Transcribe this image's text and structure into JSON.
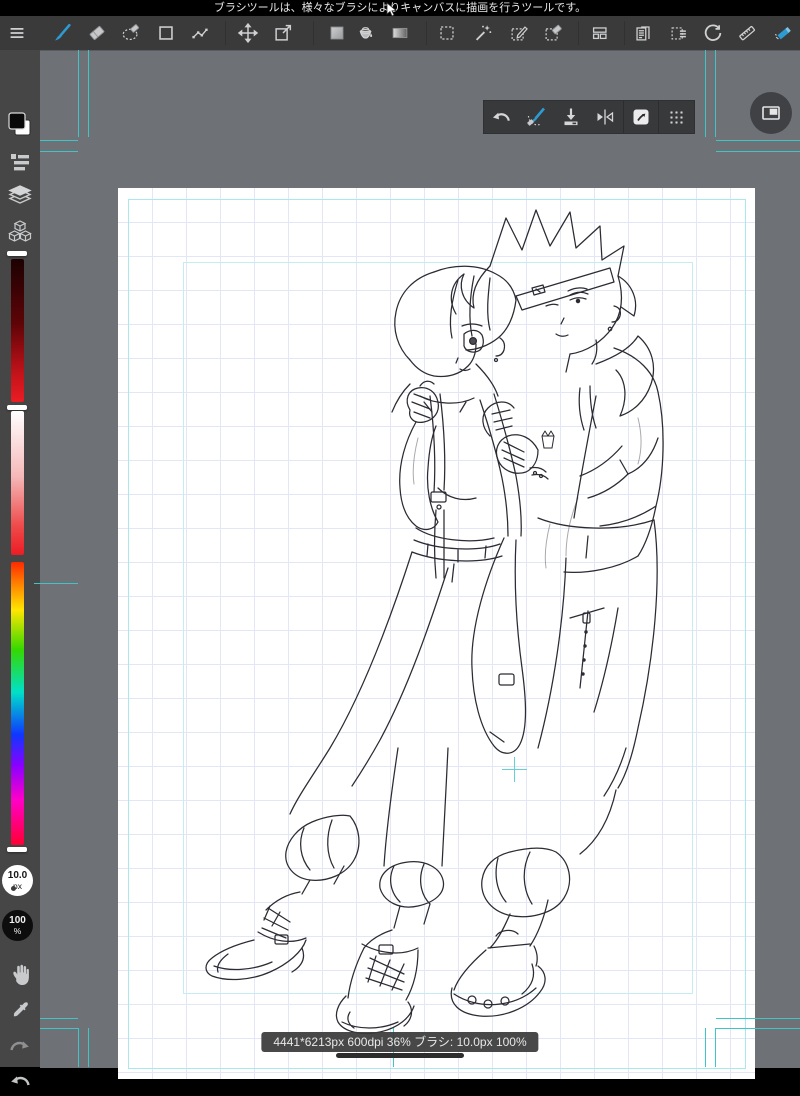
{
  "tooltip_bar": {
    "text": "ブラシツールは、様々なブラシによりキャンバスに描画を行うツールです。"
  },
  "main_toolbar": {
    "active_tool": "brush",
    "tools": [
      "menu",
      "brush",
      "eraser",
      "lasso-eraser",
      "shape-rect",
      "polyline",
      "move",
      "transform",
      "color-chip",
      "fill-bucket",
      "gradient",
      "select-rect",
      "magic-wand",
      "select-pen",
      "select-eraser",
      "panel-divide",
      "pages",
      "select-menu",
      "rotate-canvas",
      "ruler",
      "airbrush"
    ]
  },
  "floating_toolbar": {
    "buttons": [
      "undo",
      "brush-eraser-toggle",
      "save",
      "flip-horizontal",
      "snapshot",
      "drag-handle"
    ]
  },
  "left_panel": {
    "color_swatch": {
      "foreground": "#000000",
      "background": "#ffffff"
    },
    "brush_size": {
      "value": "10.0",
      "unit": "px"
    },
    "opacity": {
      "value": "100",
      "unit": "%"
    }
  },
  "status_bar": {
    "text": "4441*6213px 600dpi 36% ブラシ: 10.0px 100%"
  },
  "colors": {
    "accent_blue": "#2d9ad2",
    "guide_teal": "#3fc4c7",
    "workspace_gray": "#6e7277",
    "toolbar_bg": "#3a3a3a",
    "sidebar_bg": "#464646",
    "current_color": "#ec1c24"
  }
}
